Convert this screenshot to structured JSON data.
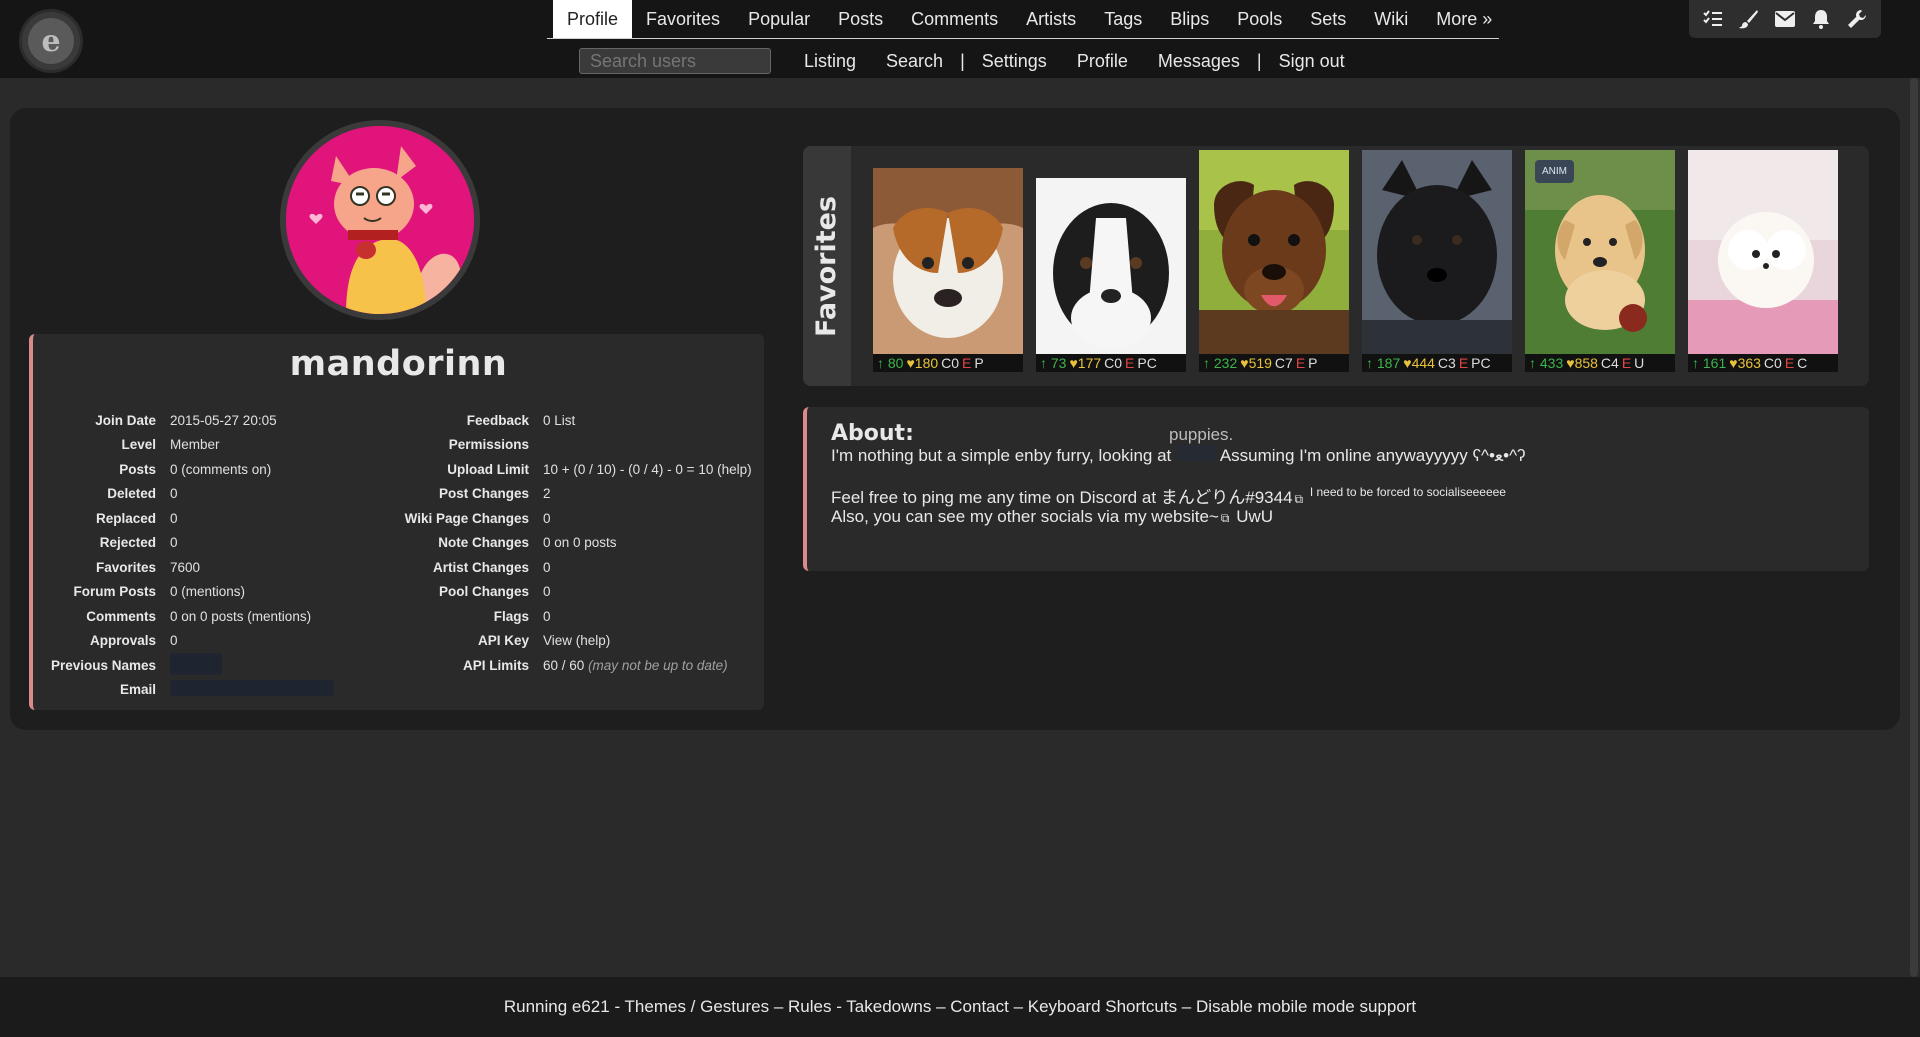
{
  "colors": {
    "accent": "#d98a8a",
    "page_bg": "#2a2a2a",
    "panel_bg": "#1e1e1e",
    "favorite_heart": "#e8c23a",
    "upvote": "#3cb54a",
    "rating_explicit": "#e04545"
  },
  "logo": {
    "glyph": "e"
  },
  "main_nav": [
    {
      "label": "Profile",
      "active": true
    },
    {
      "label": "Favorites"
    },
    {
      "label": "Popular"
    },
    {
      "label": "Posts"
    },
    {
      "label": "Comments"
    },
    {
      "label": "Artists"
    },
    {
      "label": "Tags"
    },
    {
      "label": "Blips"
    },
    {
      "label": "Pools"
    },
    {
      "label": "Sets"
    },
    {
      "label": "Wiki"
    },
    {
      "label": "More »"
    }
  ],
  "sub_nav": {
    "search_placeholder": "Search users",
    "links": [
      "Listing",
      "Search",
      "Settings",
      "Profile",
      "Messages",
      "Sign out"
    ],
    "separator": "|"
  },
  "toolbar_icons": [
    "checklist-icon",
    "brush-icon",
    "mail-icon",
    "bell-icon",
    "wrench-icon"
  ],
  "profile": {
    "username": "mandorinn",
    "left_stats": [
      {
        "key": "Join Date",
        "value": "2015-05-27 20:05"
      },
      {
        "key": "Level",
        "value": "Member"
      },
      {
        "key": "Posts",
        "value": "0 (comments on)"
      },
      {
        "key": "Deleted",
        "value": "0"
      },
      {
        "key": "Replaced",
        "value": "0"
      },
      {
        "key": "Rejected",
        "value": "0"
      },
      {
        "key": "Favorites",
        "value": "7600"
      },
      {
        "key": "Forum Posts",
        "value": "0 (mentions)"
      },
      {
        "key": "Comments",
        "value": "0 on 0 posts (mentions)"
      },
      {
        "key": "Approvals",
        "value": "0"
      },
      {
        "key": "Previous Names",
        "value": ""
      },
      {
        "key": "Email",
        "value": ""
      }
    ],
    "right_stats": [
      {
        "key": "Feedback",
        "value": "0 List"
      },
      {
        "key": "Permissions",
        "value": ""
      },
      {
        "key": "Upload Limit",
        "value": "10 + (0 / 10) - (0 / 4) - 0 = 10 (help)"
      },
      {
        "key": "Post Changes",
        "value": "2"
      },
      {
        "key": "Wiki Page Changes",
        "value": "0"
      },
      {
        "key": "Note Changes",
        "value": "0 on 0 posts"
      },
      {
        "key": "Artist Changes",
        "value": "0"
      },
      {
        "key": "Pool Changes",
        "value": "0"
      },
      {
        "key": "Flags",
        "value": "0"
      },
      {
        "key": "API Key",
        "value": "View (help)"
      },
      {
        "key": "API Limits",
        "value": "60 / 60",
        "note": "(may not be up to date)"
      }
    ]
  },
  "favorites": {
    "label": "Favorites",
    "items": [
      {
        "up": "80",
        "favs": "180",
        "comments": "C0",
        "rating": "E",
        "flags": "P",
        "anim": false,
        "img": "puppy-beagle"
      },
      {
        "up": "73",
        "favs": "177",
        "comments": "C0",
        "rating": "E",
        "flags": "PC",
        "anim": false,
        "img": "puppy-aussie"
      },
      {
        "up": "232",
        "favs": "519",
        "comments": "C7",
        "rating": "E",
        "flags": "P",
        "anim": false,
        "img": "puppy-lab-brown"
      },
      {
        "up": "187",
        "favs": "444",
        "comments": "C3",
        "rating": "E",
        "flags": "PC",
        "anim": false,
        "img": "puppy-black"
      },
      {
        "up": "433",
        "favs": "858",
        "comments": "C4",
        "rating": "E",
        "flags": "U",
        "anim": true,
        "anim_label": "ANIM",
        "img": "puppy-golden"
      },
      {
        "up": "161",
        "favs": "363",
        "comments": "C0",
        "rating": "E",
        "flags": "C",
        "anim": false,
        "img": "puppy-pomeranian"
      }
    ]
  },
  "about": {
    "title": "About:",
    "floating": "puppies.",
    "line1_a": "I'm nothing but a simple enby furry, looking at",
    "line1_b": "Assuming I'm online anywayyyyy ʕ^•ﻌ•^ʔ",
    "line2_a": "Feel free to ping me any time on Discord at まんどりん#9344",
    "line2_small": "I need to be forced to socialiseeeeee",
    "line3_a": "Also, you can see my other socials via my website~",
    "line3_b": "UwU"
  },
  "footer": {
    "parts": [
      "Running e621",
      " - ",
      "Themes",
      " / ",
      "Gestures",
      " – ",
      "Rules",
      " - ",
      "Takedowns",
      " – ",
      "Contact",
      " – ",
      "Keyboard Shortcuts",
      " – ",
      "Disable mobile mode support"
    ]
  }
}
